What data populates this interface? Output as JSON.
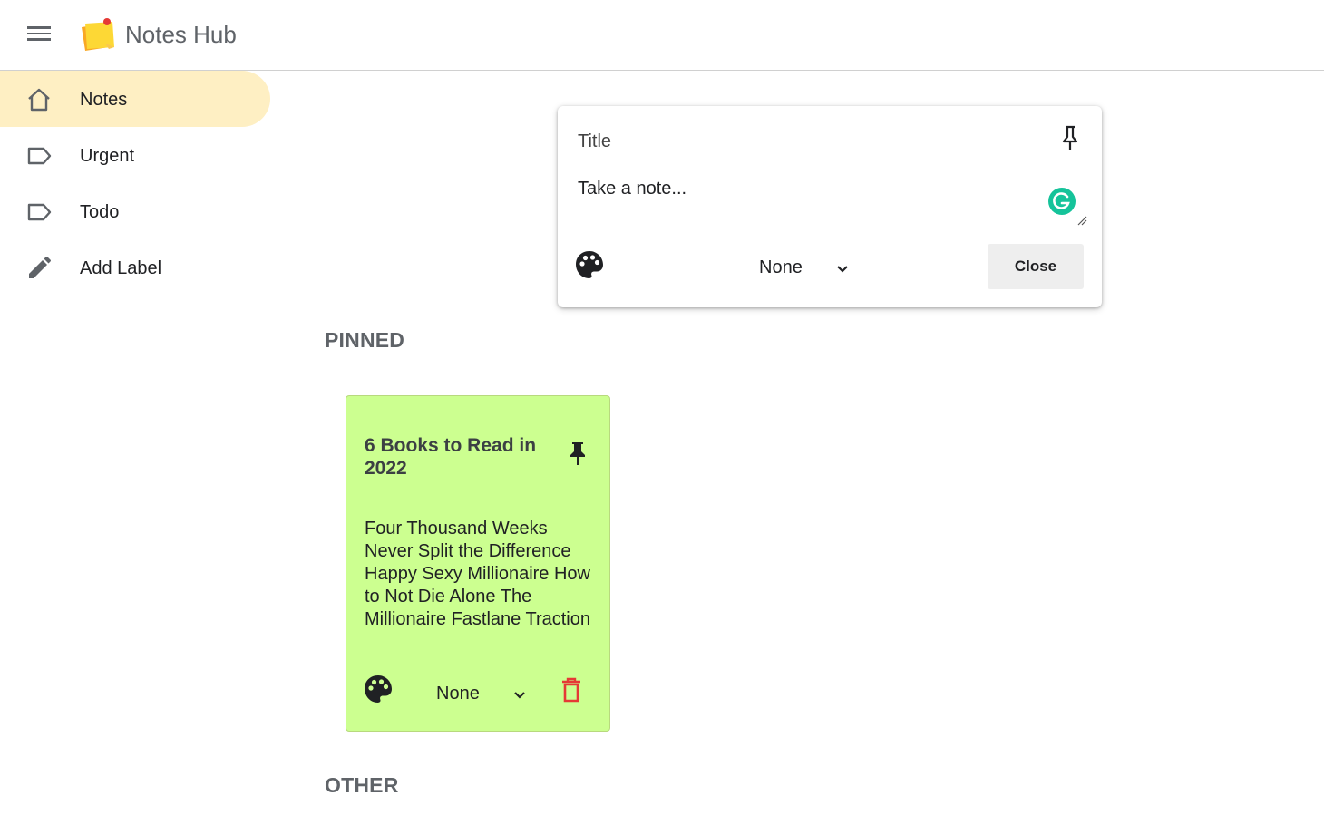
{
  "app": {
    "title": "Notes Hub",
    "logo_icon": "sticky-note-logo"
  },
  "sidebar": {
    "items": [
      {
        "label": "Notes",
        "icon": "home-icon",
        "active": true
      },
      {
        "label": "Urgent",
        "icon": "label-icon",
        "active": false
      },
      {
        "label": "Todo",
        "icon": "label-icon",
        "active": false
      },
      {
        "label": "Add Label",
        "icon": "pencil-icon",
        "active": false
      }
    ]
  },
  "composer": {
    "title_placeholder": "Title",
    "body_placeholder": "Take a note...",
    "label_select_value": "None",
    "close_label": "Close"
  },
  "sections": {
    "pinned": "PINNED",
    "other": "OTHER"
  },
  "notes": [
    {
      "title": "6 Books to Read in 2022",
      "body": "Four Thousand Weeks Never Split the Difference Happy Sexy Millionaire How to Not Die Alone The Millionaire Fastlane Traction",
      "label": "None",
      "color": "#ccff90",
      "pinned": true
    }
  ],
  "colors": {
    "active_nav": "#feefc3",
    "note_green": "#ccff90",
    "delete_red": "#e53935",
    "grammarly": "#15c39a"
  }
}
